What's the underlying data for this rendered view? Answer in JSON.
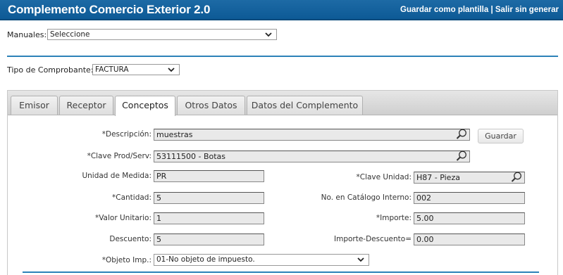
{
  "header": {
    "title": "Complemento Comercio Exterior 2.0",
    "save_template": "Guardar como plantilla",
    "separator": " | ",
    "exit": "Salir sin generar"
  },
  "manuales": {
    "label": "Manuales:",
    "value": "Seleccione"
  },
  "tipo": {
    "label": "Tipo de Comprobante:",
    "value": "FACTURA"
  },
  "tabs": [
    {
      "label": "Emisor"
    },
    {
      "label": "Receptor"
    },
    {
      "label": "Conceptos"
    },
    {
      "label": "Otros Datos"
    },
    {
      "label": "Datos del Complemento"
    }
  ],
  "active_tab": "Conceptos",
  "form": {
    "descripcion": {
      "label": "*Descripción:",
      "value": "muestras"
    },
    "guardar": "Guardar",
    "clave_prod": {
      "label": "*Clave Prod/Serv:",
      "value": "53111500 - Botas"
    },
    "unidad": {
      "label": "Unidad de Medida:",
      "value": "PR"
    },
    "clave_unidad": {
      "label": "*Clave Unidad:",
      "value": "H87 - Pieza"
    },
    "cantidad": {
      "label": "*Cantidad:",
      "value": "5"
    },
    "catalogo": {
      "label": "No. en Catálogo Interno:",
      "value": "002"
    },
    "valor_unitario": {
      "label": "*Valor Unitario:",
      "value": "1"
    },
    "importe": {
      "label": "*Importe:",
      "value": "5.00"
    },
    "descuento": {
      "label": "Descuento:",
      "value": "5"
    },
    "importe_descuento": {
      "label": "Importe-Descuento=",
      "value": "0.00"
    },
    "objeto_imp": {
      "label": "*Objeto Imp.:",
      "value": "01-No objeto de impuesto."
    }
  },
  "colors": {
    "header_bg": "#1d6aa5",
    "rule": "#2c82b8"
  }
}
